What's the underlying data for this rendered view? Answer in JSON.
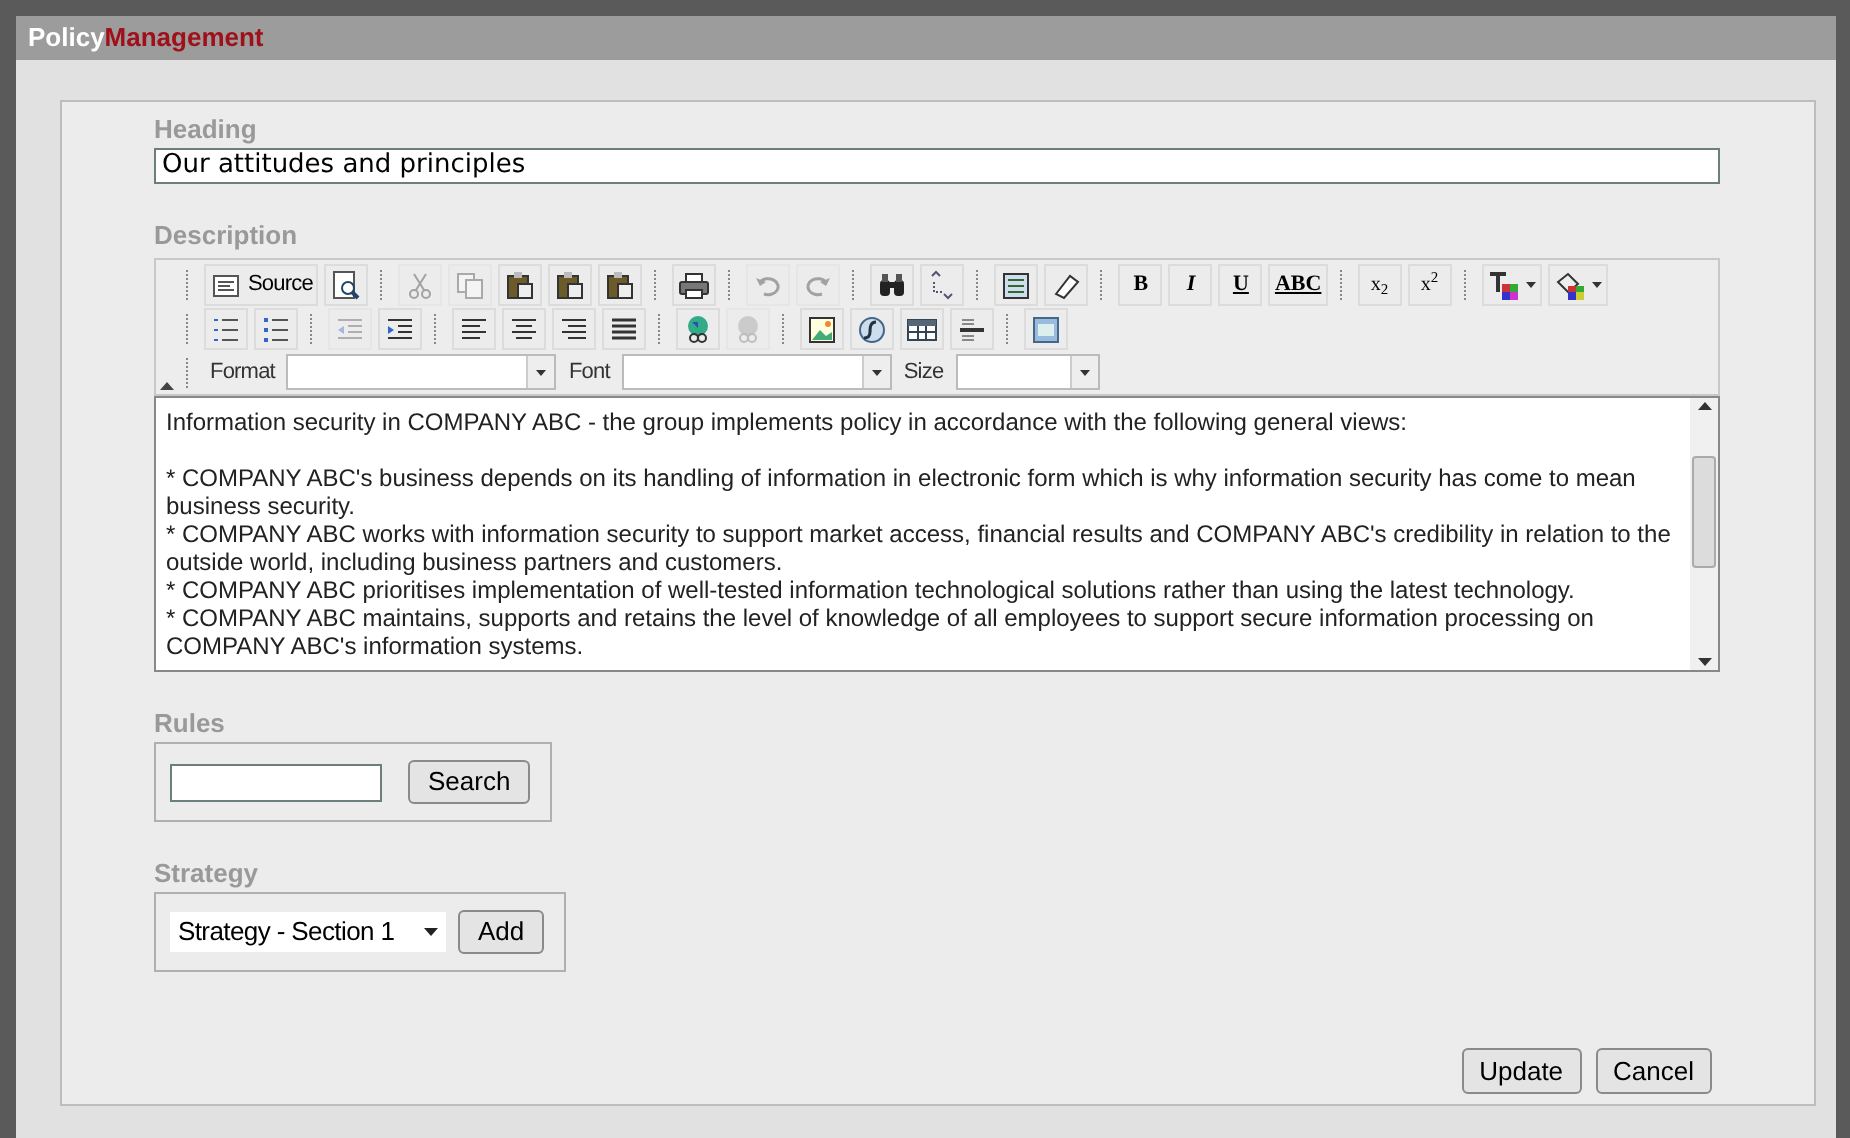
{
  "window": {
    "title_parts": [
      "Policy",
      "Management"
    ]
  },
  "heading": {
    "label": "Heading",
    "value": "Our attitudes and principles"
  },
  "description": {
    "label": "Description",
    "toolbar_rows": [
      [
        [
          {
            "kind": "source",
            "label": "Source",
            "disabled": false
          },
          {
            "kind": "preview",
            "disabled": false
          }
        ],
        [
          {
            "kind": "cut",
            "disabled": true
          },
          {
            "kind": "copy",
            "disabled": true
          },
          {
            "kind": "paste",
            "disabled": false
          },
          {
            "kind": "paste",
            "disabled": false
          },
          {
            "kind": "paste",
            "disabled": false
          }
        ],
        [
          {
            "kind": "print",
            "disabled": false
          }
        ],
        [
          {
            "kind": "undo",
            "disabled": true
          },
          {
            "kind": "redo",
            "disabled": true
          }
        ],
        [
          {
            "kind": "find",
            "disabled": false
          },
          {
            "kind": "replace",
            "disabled": false
          }
        ],
        [
          {
            "kind": "selectall",
            "disabled": false
          },
          {
            "kind": "eraser",
            "disabled": false
          }
        ],
        [
          {
            "kind": "glyph",
            "label": "B",
            "disabled": false
          },
          {
            "kind": "glyph",
            "label": "I",
            "disabled": false
          },
          {
            "kind": "glyph",
            "label": "U",
            "disabled": false
          },
          {
            "kind": "glyph",
            "label": "ABC",
            "disabled": false
          }
        ],
        [
          {
            "kind": "glyph",
            "label": "x$_{2}$",
            "disabled": false
          },
          {
            "kind": "glyph",
            "label": "x$^{2}$",
            "disabled": false
          }
        ],
        [
          {
            "kind": "textcolor",
            "disabled": false
          },
          {
            "kind": "bgcolor",
            "disabled": false
          }
        ]
      ],
      [
        [
          {
            "kind": "ol",
            "disabled": false
          },
          {
            "kind": "ul",
            "disabled": false
          }
        ],
        [
          {
            "kind": "outdent",
            "disabled": true
          },
          {
            "kind": "indent",
            "disabled": false
          }
        ],
        [
          {
            "kind": "left",
            "disabled": false
          },
          {
            "kind": "center",
            "disabled": false
          },
          {
            "kind": "right",
            "disabled": false
          },
          {
            "kind": "justify",
            "disabled": false
          }
        ],
        [
          {
            "kind": "link",
            "disabled": false
          },
          {
            "kind": "unlink",
            "disabled": true
          }
        ],
        [
          {
            "kind": "image",
            "disabled": false
          },
          {
            "kind": "flash",
            "disabled": false
          },
          {
            "kind": "table",
            "disabled": false
          },
          {
            "kind": "hr",
            "disabled": false
          }
        ],
        [
          {
            "kind": "box",
            "disabled": false
          }
        ]
      ]
    ],
    "dropdowns": [
      "Format",
      "Font",
      "Size"
    ],
    "intro": "Information security in COMPANY ABC - the group implements policy in accordance with the following general views:",
    "points": [
      "* COMPANY ABC's business depends on its handling of information in electronic form which is why information security has come to mean business security.",
      "* COMPANY ABC works with information security to support market access, financial results and COMPANY ABC's credibility in relation to the outside world, including business partners and customers.",
      "* COMPANY ABC prioritises implementation of well-tested information technological solutions rather than using the latest technology.",
      "* COMPANY ABC maintains, supports and retains the level of knowledge of all employees to support secure information processing on COMPANY ABC's information systems."
    ]
  },
  "rules": {
    "label": "Rules",
    "button": "Search"
  },
  "strategy": {
    "label": "Strategy",
    "value": "Strategy - Section 1",
    "button": "Add"
  },
  "buttons": [
    "Update",
    "Cancel"
  ]
}
